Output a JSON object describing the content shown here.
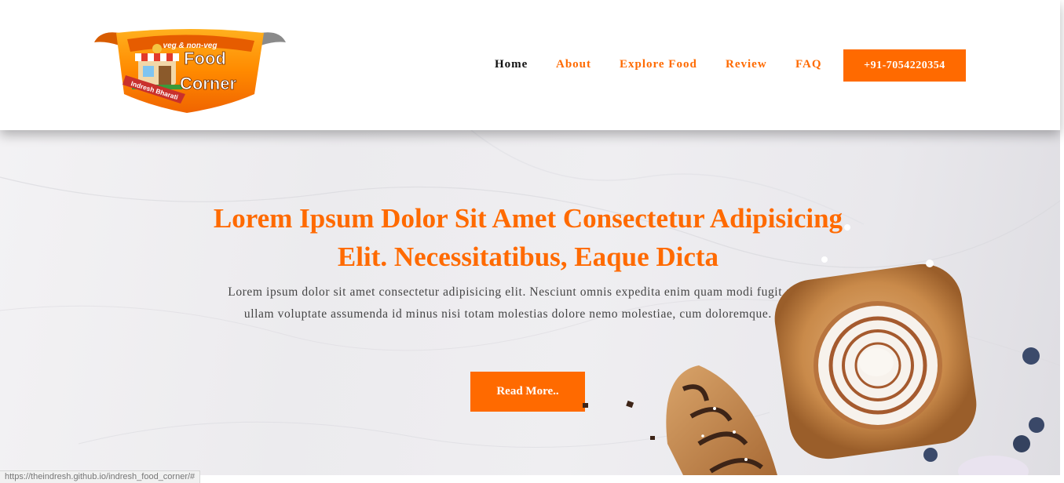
{
  "logo": {
    "banner_text": "veg & non-veg",
    "title_line1": "Food",
    "title_line2": "Corner",
    "ribbon_text": "Indresh Bharati"
  },
  "nav": {
    "items": [
      {
        "label": "Home",
        "active": true
      },
      {
        "label": "About",
        "active": false
      },
      {
        "label": "Explore Food",
        "active": false
      },
      {
        "label": "Review",
        "active": false
      },
      {
        "label": "FAQ",
        "active": false
      }
    ],
    "phone_label": "+91-7054220354"
  },
  "hero": {
    "title": "Lorem Ipsum Dolor Sit Amet Consectetur Adipisicing Elit. Necessitatibus, Eaque Dicta",
    "text": "Lorem ipsum dolor sit amet consectetur adipisicing elit. Nesciunt omnis expedita enim quam modi fugit aliquam ullam voluptate assumenda id minus nisi totam molestias dolore nemo molestiae, cum doloremque. Itaque.",
    "button_label": "Read More.."
  },
  "status_bar": {
    "url": "https://theindresh.github.io/indresh_food_corner/#"
  },
  "colors": {
    "accent": "#ff6a00",
    "nav_active": "#111111",
    "header_bg": "#ffffff",
    "hero_bg": "#efeef1"
  }
}
